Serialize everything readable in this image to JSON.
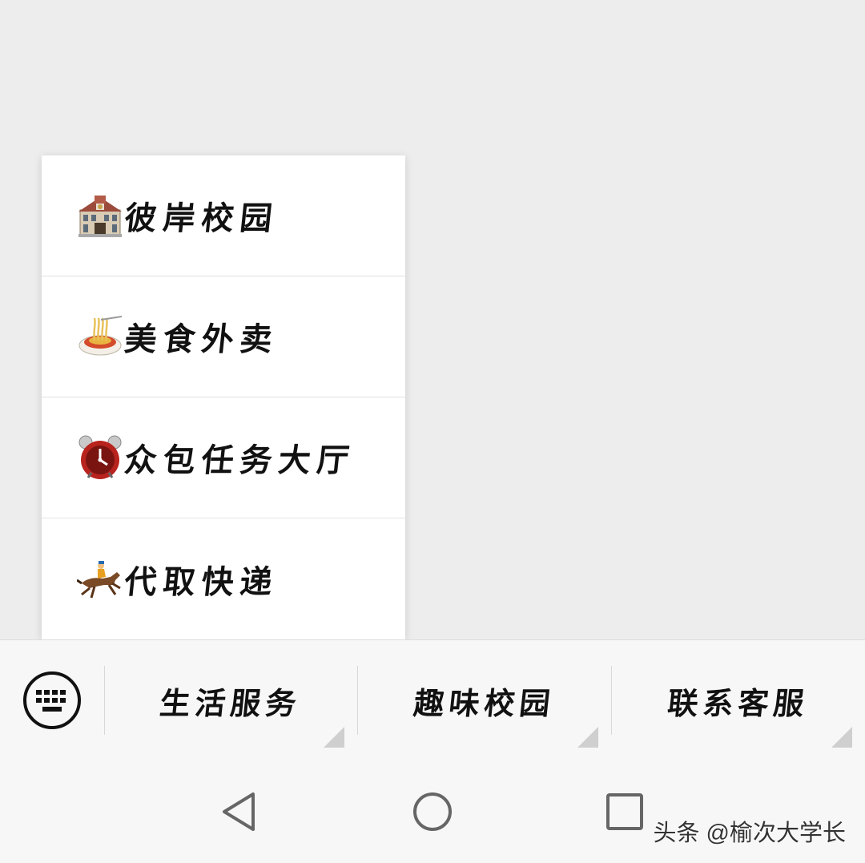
{
  "popup_menu": {
    "items": [
      {
        "label": "彼岸校园",
        "icon": "school-building-icon"
      },
      {
        "label": "美食外卖",
        "icon": "noodle-bowl-icon"
      },
      {
        "label": "众包任务大厅",
        "icon": "alarm-clock-icon"
      },
      {
        "label": "代取快递",
        "icon": "horse-racing-icon"
      }
    ]
  },
  "menu_bar": {
    "keyboard_icon": "keyboard-icon",
    "tabs": [
      {
        "label": "生活服务"
      },
      {
        "label": "趣味校园"
      },
      {
        "label": "联系客服"
      }
    ]
  },
  "nav_bar": {
    "back_icon": "back-triangle-icon",
    "home_icon": "home-circle-icon",
    "recents_icon": "recents-square-icon"
  },
  "watermark": "头条 @榆次大学长",
  "colors": {
    "background": "#ededed",
    "menu_background": "#ffffff",
    "text": "#111111",
    "bar_background": "#f7f7f7"
  }
}
